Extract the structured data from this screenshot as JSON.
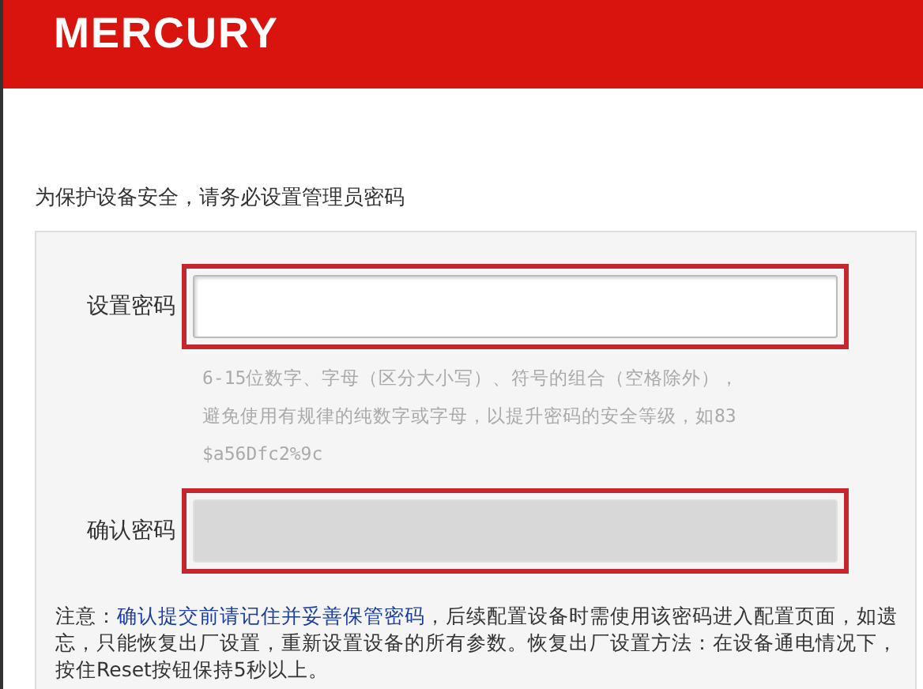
{
  "header": {
    "logo": "MERCURY"
  },
  "intro": "为保护设备安全，请务必设置管理员密码",
  "fields": [
    {
      "label": "设置密码",
      "disabled": false,
      "highlighted": true,
      "hint_lines": [
        "6-15位数字、字母（区分大小写）、符号的组合（空格除外），",
        "避免使用有规律的纯数字或字母，以提升密码的安全等级，如83",
        "$a56Dfc2%9c"
      ]
    },
    {
      "label": "确认密码",
      "disabled": true,
      "highlighted": true
    }
  ],
  "note": {
    "prefix": "注意：",
    "emphasis": "确认提交前请记住并妥善保管密码",
    "rest": "，后续配置设备时需使用该密码进入配置页面，如遗忘，只能恢复出厂设置，重新设置设备的所有参数。恢复出厂设置方法：在设备通电情况下，按住Reset按钮保持5秒以上。"
  }
}
